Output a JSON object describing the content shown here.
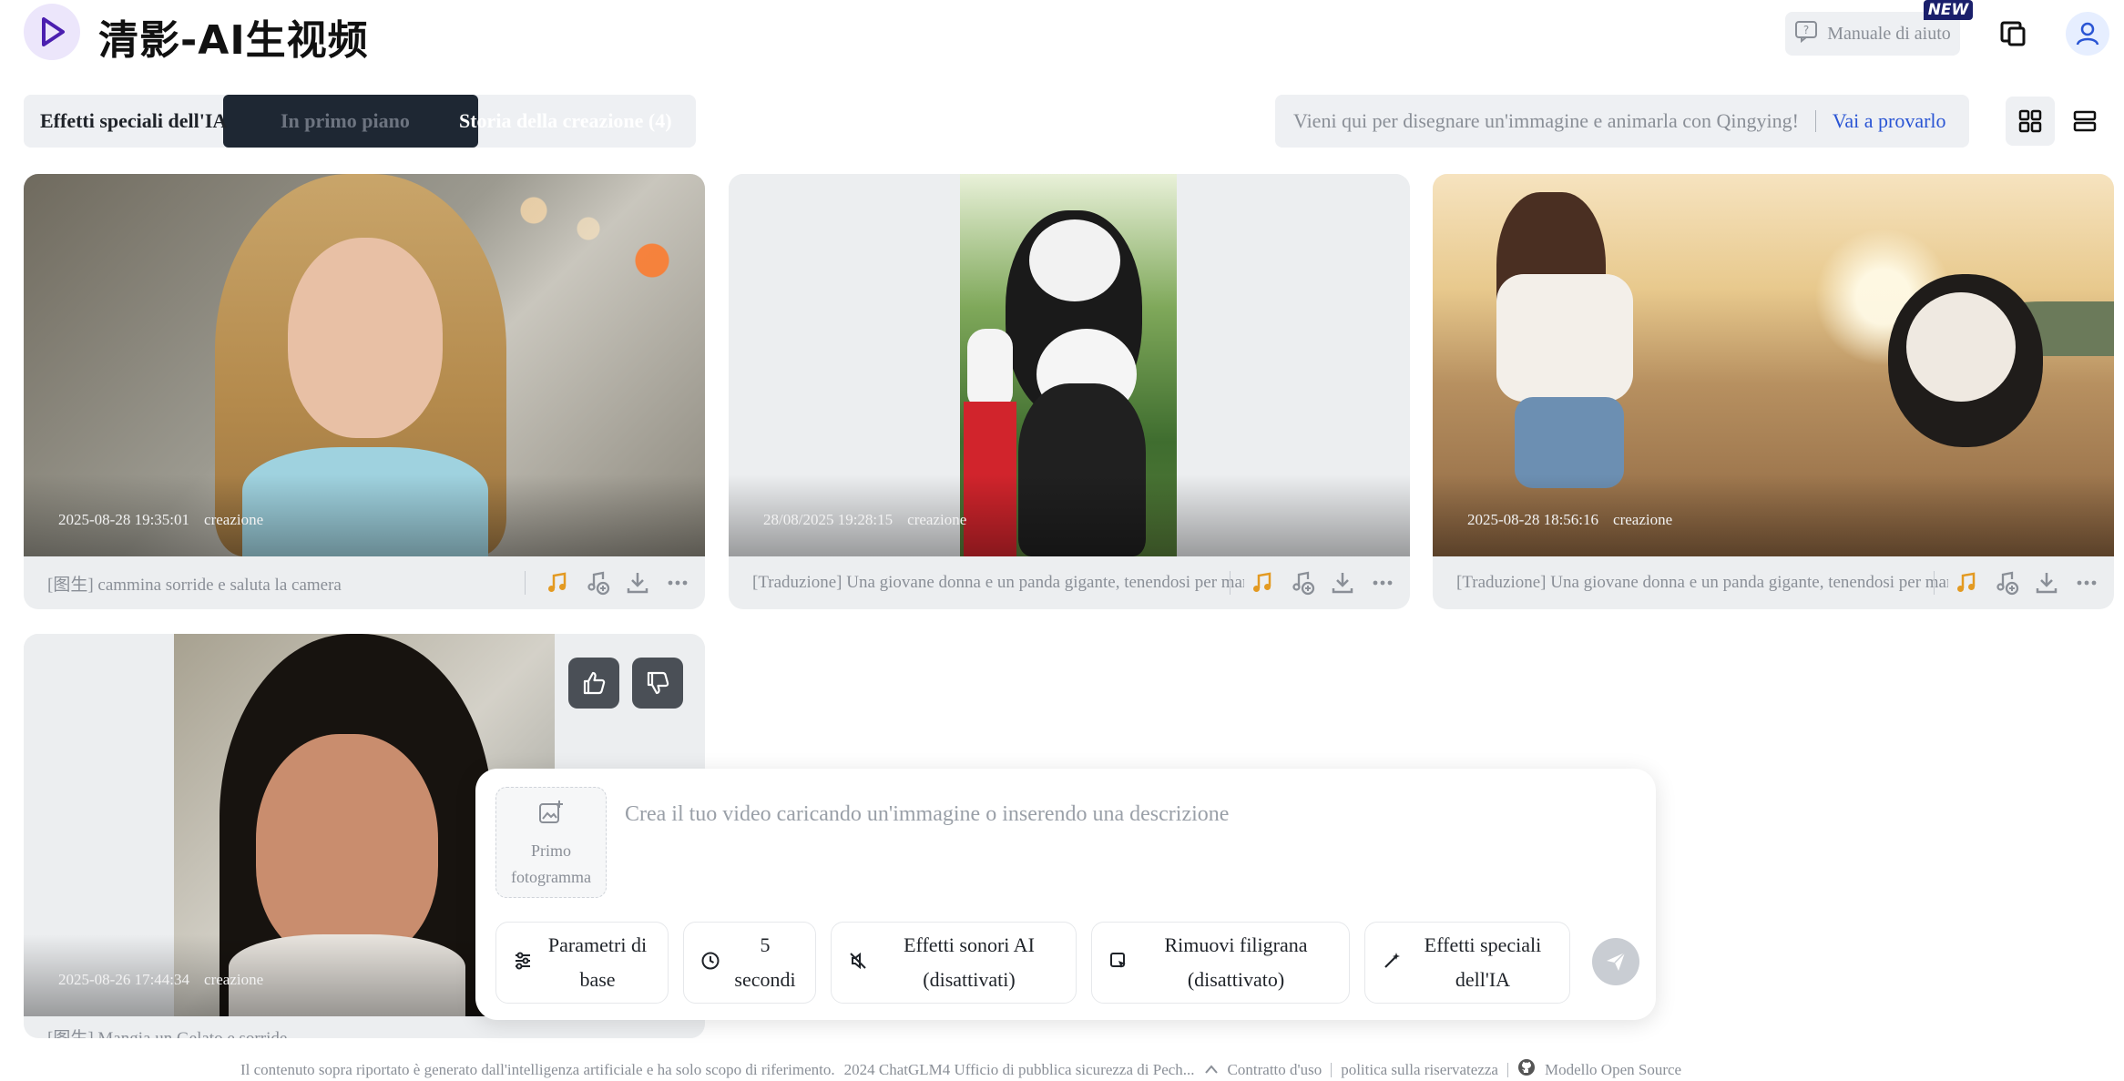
{
  "header": {
    "brand": "清影-AI生视频",
    "help_label": "Manuale di aiuto",
    "new_badge": "NEW"
  },
  "tabs": [
    {
      "label": "Effetti speciali dell'IA",
      "active": false
    },
    {
      "label": "In primo piano",
      "active": true
    },
    {
      "label": "Storia della creazione (4)",
      "active": false
    }
  ],
  "promo": {
    "text": "Vieni qui per disegnare un'immagine e animarla con Qingying!",
    "link": "Vai a provarlo"
  },
  "cards": [
    {
      "date": "2025-08-28 19:35:01",
      "tag": "creazione",
      "caption": "[图生] cammina sorride e saluta la camera"
    },
    {
      "date": "28/08/2025 19:28:15",
      "tag": "creazione",
      "caption": "[Traduzione] Una giovane donna e un panda gigante, tenendosi per mano"
    },
    {
      "date": "2025-08-28 18:56:16",
      "tag": "creazione",
      "caption": "[Traduzione] Una giovane donna e un panda gigante, tenendosi per mano"
    },
    {
      "date": "2025-08-26 17:44:34",
      "tag": "creazione",
      "caption": "[图生] Mangia un Gelato e sorride"
    }
  ],
  "composer": {
    "first_frame_label": "Primo fotogramma",
    "placeholder": "Crea il tuo video caricando un'immagine o inserendo una descrizione",
    "options": [
      {
        "label": "Parametri di base",
        "icon": "sliders-icon"
      },
      {
        "label": "5 secondi",
        "icon": "clock-icon"
      },
      {
        "label": "Effetti sonori AI (disattivati)",
        "icon": "sound-off-icon"
      },
      {
        "label": "Rimuovi filigrana (disattivato)",
        "icon": "watermark-icon"
      },
      {
        "label": "Effetti speciali dell'IA",
        "icon": "magic-wand-icon"
      }
    ]
  },
  "footer": {
    "disclaimer": "Il contenuto sopra riportato è generato dall'intelligenza artificiale e ha solo scopo di riferimento.",
    "license": "2024 ChatGLM4 Ufficio di pubblica sicurezza di Pech...",
    "terms": "Contratto d'uso",
    "privacy": "politica sulla riservatezza",
    "open_source": "Modello Open Source"
  },
  "colors": {
    "accent": "#2a55d4",
    "tab_active_bg": "#1e2733",
    "brand_purple": "#7b3fe4",
    "music_icon": "#e39a22"
  }
}
